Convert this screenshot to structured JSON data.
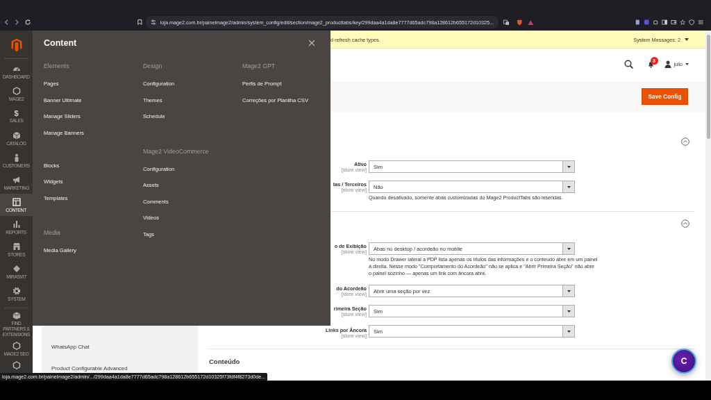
{
  "browser": {
    "url": "loja.mage2.com.br/painelmage2/admin/system_config/edit/section/mage2_producttabs/key/299daa4a1da8e7777d65adc798a128612b655172d10325...",
    "status_url": "loja.mage2.com.br/painelmage2/admin/.../299daa4a1da8e7777d65adc798a128612b655172d10325f73fdf4f8273d0de..."
  },
  "sidebar": {
    "items": [
      {
        "kind": "dashboard",
        "label": "DASHBOARD",
        "selected": false
      },
      {
        "kind": "hexagon",
        "label": "MAGE2",
        "selected": false
      },
      {
        "kind": "glyph",
        "glyph": "$",
        "label": "SALES",
        "selected": false
      },
      {
        "kind": "cube",
        "label": "CATALOG",
        "selected": false
      },
      {
        "kind": "person",
        "label": "CUSTOMERS",
        "selected": false
      },
      {
        "kind": "megaphone",
        "label": "MARKETING",
        "selected": false
      },
      {
        "kind": "layout",
        "label": "CONTENT",
        "selected": true
      },
      {
        "kind": "bars",
        "label": "REPORTS",
        "selected": false
      },
      {
        "kind": "store",
        "label": "STORES",
        "selected": false
      },
      {
        "kind": "diamond",
        "label": "MIRASVIT",
        "selected": false
      },
      {
        "kind": "gear",
        "label": "SYSTEM",
        "selected": false
      },
      {
        "kind": "box",
        "label": "FIND PARTNERS & EXTENSIONS",
        "selected": false
      },
      {
        "kind": "hexagon",
        "label": "MAGE2 SEO",
        "selected": false
      },
      {
        "kind": "hexagon",
        "selected": false
      }
    ]
  },
  "flyout": {
    "title": "Content",
    "columns": [
      [
        {
          "heading": "Elements",
          "items": [
            "Pages",
            "Banner Ultimate",
            "Manage Sliders",
            "Manage Banners"
          ]
        },
        {
          "items": [
            "Blocks",
            "Widgets",
            "Templates"
          ]
        },
        {
          "heading": "Media",
          "items": [
            "Media Gallery"
          ]
        }
      ],
      [
        {
          "heading": "Design",
          "items": [
            "Configuration",
            "Themes",
            "Schedule"
          ]
        },
        {
          "heading": "Mage2 VideoCommerce",
          "items": [
            "Configuration",
            "Assets",
            "Comments",
            "Videos",
            "Tags"
          ]
        }
      ],
      [
        {
          "heading": "Mage2 GPT",
          "items": [
            "Perfis de Prompt",
            "Correções por Planilha CSV"
          ]
        }
      ]
    ]
  },
  "system_message": {
    "text": "d refresh cache types.",
    "link": "System Messages: 2"
  },
  "header": {
    "notification_count": "3",
    "user": "julio"
  },
  "actions": {
    "save": "Save Config"
  },
  "config_tabs": [
    "WhatsApp Chat",
    "Product Configurable Advanced"
  ],
  "sections": [
    {
      "expanded": true,
      "fields": [
        {
          "label": "Ativo",
          "scope": "[store view]",
          "value": "Sim"
        },
        {
          "label": "tas / Terceiros",
          "scope": "[store view]",
          "value": "Não",
          "note": "Quando desativado, somente abas customizadas do Mage2 ProductTabs são inseridas."
        }
      ]
    },
    {
      "expanded": true,
      "fields": [
        {
          "label": "o de Exibição",
          "scope": "[store view]",
          "value": "Abas no desktop / acordeão no mobile",
          "note": "No modo Drawer lateral a PDP lista apenas os títulos das informações e o conteúdo abre em um painel à direita. Nesse modo \"Comportamento do Acordeão\" não se aplica e \"Abrir Primeira Seção\" não abre o painel sozinho — apenas um link com âncora abre."
        },
        {
          "label": "do Acordeão",
          "scope": "[store view]",
          "value": "Abrir uma seção por vez"
        },
        {
          "label": "rimeira Seção",
          "scope": "[store view]",
          "value": "Sim"
        },
        {
          "label": "Links por Âncora",
          "scope": "[store view]",
          "value": "Sim"
        }
      ]
    },
    {
      "title": "Conteúdo"
    }
  ],
  "chat": {
    "label": "C"
  }
}
